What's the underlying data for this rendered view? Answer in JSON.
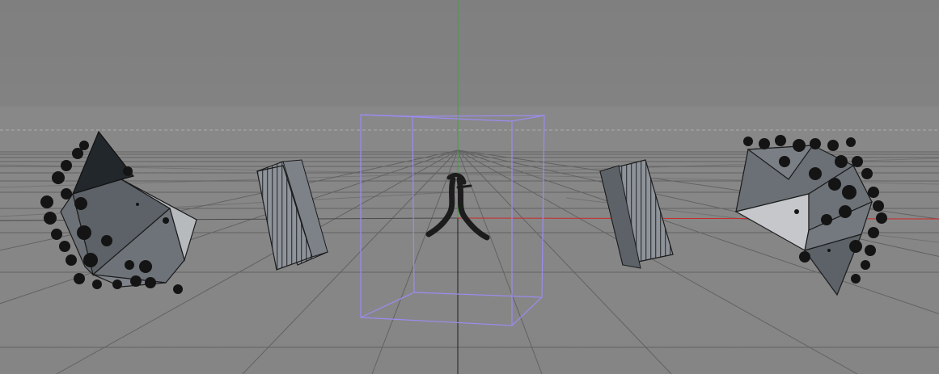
{
  "viewport": {
    "view": "perspective",
    "background_top": "#7e7e7e",
    "background_floor": "#858585",
    "grid_color": "#5a5a5a",
    "axis_colors": {
      "x": "#cc2a2a",
      "y": "#2bb02b"
    },
    "selection_color": "#9b8cf0",
    "horizon_dashed": true
  },
  "scene": {
    "objects": [
      {
        "kind": "faceted polyhedron with bolts",
        "selected": false
      },
      {
        "kind": "tilted ribbed block",
        "selected": false
      },
      {
        "kind": "bent wire figure",
        "selected": true
      },
      {
        "kind": "tilted ribbed block",
        "selected": false
      },
      {
        "kind": "faceted polyhedron with bolts",
        "selected": false
      }
    ]
  }
}
